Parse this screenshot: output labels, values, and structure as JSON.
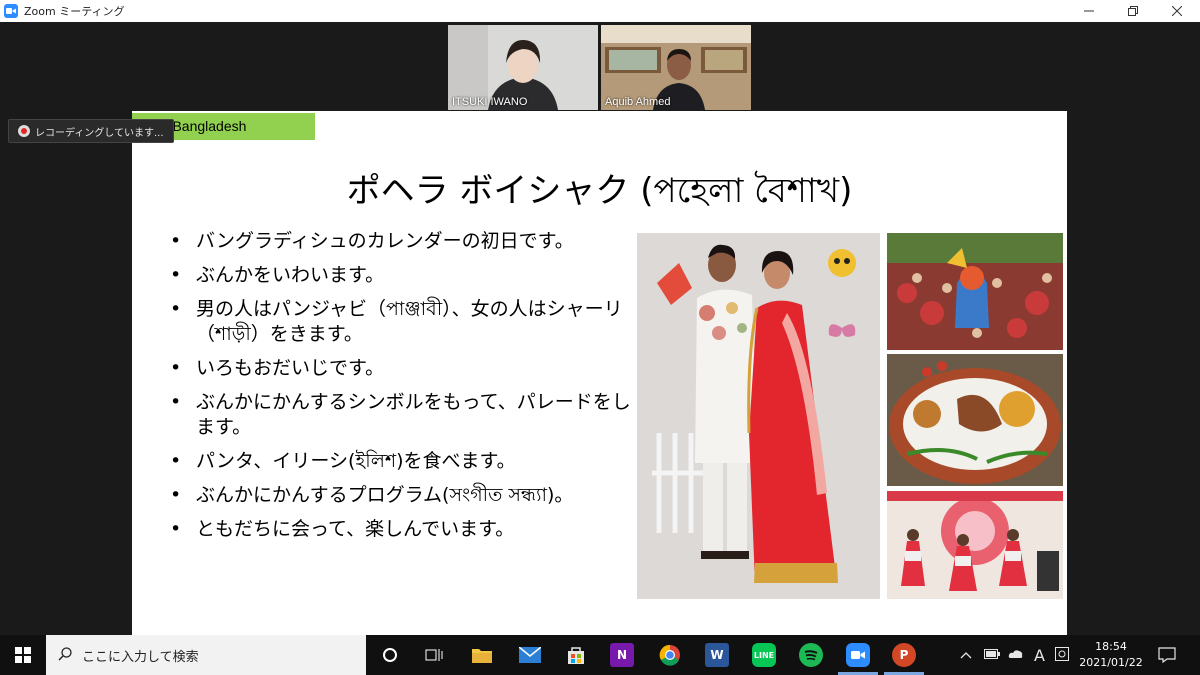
{
  "window": {
    "title": "Zoom ミーティング"
  },
  "participants": [
    {
      "name": "ITSUKI IWANO"
    },
    {
      "name": "Aquib Ahmed"
    }
  ],
  "recording": {
    "label": "レコーディングしています..."
  },
  "slide": {
    "corner_label": "min Bangladesh",
    "title": "ポヘラ ボイシャク (পহেলা বৈশাখ)",
    "bullets": [
      "バングラディシュのカレンダーの初日です。",
      "ぶんかをいわいます。",
      "男の人はパンジャビ（পাঞ্জাবী）、女の人はシャーリ（শাড়ী）をきます。",
      "いろもおだいじです。",
      "ぶんかにかんするシンボルをもって、パレードをします。",
      "パンタ、イリーシ(ইলিশ)を食べます。",
      "ぶんかにかんするプログラム(সংগীত সন্ধ্যা)。",
      "ともだちに会って、楽しんでいます。"
    ]
  },
  "taskbar": {
    "search_placeholder": "ここに入力して検索",
    "clock_time": "18:54",
    "clock_date": "2021/01/22",
    "ime": "A"
  },
  "icons": [
    "windows-start-icon",
    "search-icon",
    "cortana-icon",
    "task-view-icon",
    "file-explorer-icon",
    "mail-icon",
    "store-icon",
    "onenote-icon",
    "chrome-icon",
    "word-icon",
    "line-icon",
    "spotify-icon",
    "zoom-icon",
    "powerpoint-icon"
  ],
  "colors": {
    "slide_label": "#92d050",
    "zoom_blue": "#2d8cff",
    "taskbar": "#101010"
  }
}
